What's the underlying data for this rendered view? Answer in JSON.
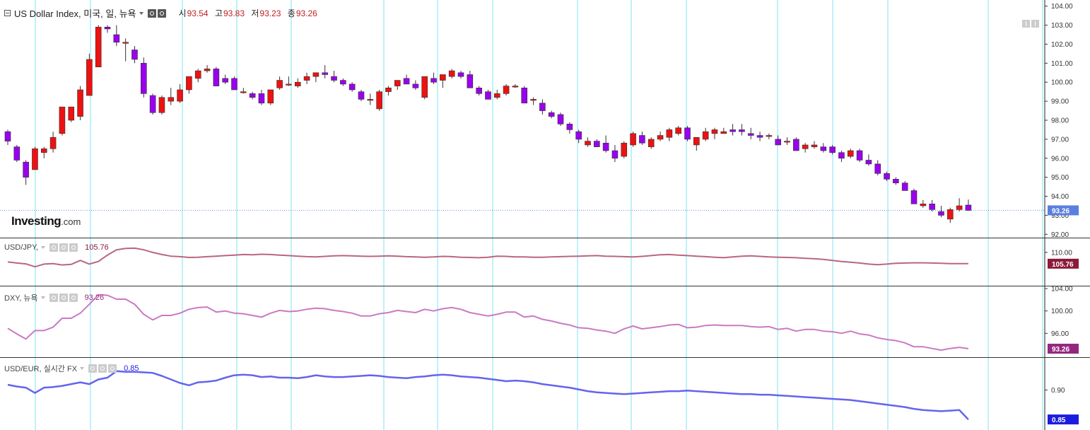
{
  "header": {
    "symbol_label": "US Dollar Index, 미국, 일, 뉴욕",
    "open_key": "시",
    "open_val": "93.54",
    "high_key": "고",
    "high_val": "93.83",
    "low_key": "저",
    "low_val": "93.23",
    "close_key": "종",
    "close_val": "93.26"
  },
  "logo": {
    "main": "Investing",
    "suffix": ".com"
  },
  "colors": {
    "bull": "#ee1111",
    "bear": "#9900ee",
    "wick": "#333333",
    "grid_cyan": "#7fe3f0",
    "price_line": "#6f8fe0",
    "usdjpy": "#b9677d",
    "dxy": "#c97ac3",
    "usdeur": "#6464ee",
    "badge_jpy": "#8b1a3a",
    "badge_dxy": "#94287f",
    "badge_eur": "#1c1ce0"
  },
  "chart_data": [
    {
      "type": "candlestick",
      "name": "US Dollar Index",
      "ylim": [
        91.9,
        104.1
      ],
      "y_ticks": [
        "104.00",
        "103.00",
        "102.00",
        "101.00",
        "100.00",
        "99.00",
        "98.00",
        "97.00",
        "96.00",
        "95.00",
        "94.00",
        "93.00",
        "92.00"
      ],
      "last_value_label": "93.26",
      "candles": [
        [
          97.4,
          97.5,
          96.7,
          96.9
        ],
        [
          96.6,
          96.7,
          95.8,
          95.9
        ],
        [
          95.8,
          95.9,
          94.6,
          95.0
        ],
        [
          95.4,
          96.6,
          95.4,
          96.5
        ],
        [
          96.3,
          96.6,
          96.0,
          96.5
        ],
        [
          96.5,
          97.4,
          96.3,
          97.1
        ],
        [
          97.3,
          98.7,
          97.2,
          98.7
        ],
        [
          98.0,
          98.7,
          97.9,
          98.7
        ],
        [
          98.2,
          99.8,
          98.0,
          99.6
        ],
        [
          99.3,
          101.5,
          99.3,
          101.2
        ],
        [
          100.8,
          103.0,
          100.8,
          102.9
        ],
        [
          102.9,
          103.0,
          102.6,
          102.8
        ],
        [
          102.5,
          103.0,
          101.9,
          102.1
        ],
        [
          102.1,
          102.3,
          101.1,
          102.1
        ],
        [
          101.7,
          101.9,
          101.0,
          101.2
        ],
        [
          101.0,
          101.3,
          99.2,
          99.4
        ],
        [
          99.3,
          99.4,
          98.3,
          98.4
        ],
        [
          98.4,
          99.3,
          98.3,
          99.2
        ],
        [
          99.0,
          99.7,
          98.8,
          99.2
        ],
        [
          99.0,
          99.9,
          98.9,
          99.6
        ],
        [
          99.6,
          100.3,
          99.4,
          100.3
        ],
        [
          100.2,
          100.7,
          100.0,
          100.6
        ],
        [
          100.6,
          100.9,
          100.5,
          100.7
        ],
        [
          100.7,
          100.8,
          99.8,
          99.8
        ],
        [
          100.2,
          100.4,
          99.9,
          100.0
        ],
        [
          100.2,
          100.3,
          99.6,
          99.6
        ],
        [
          99.5,
          99.7,
          99.4,
          99.5
        ],
        [
          99.4,
          99.5,
          99.1,
          99.2
        ],
        [
          99.4,
          99.6,
          98.8,
          98.9
        ],
        [
          98.9,
          99.6,
          98.8,
          99.6
        ],
        [
          99.7,
          100.3,
          99.6,
          100.1
        ],
        [
          99.9,
          100.3,
          99.8,
          99.9
        ],
        [
          99.8,
          100.2,
          99.7,
          100.0
        ],
        [
          100.1,
          100.5,
          99.9,
          100.3
        ],
        [
          100.3,
          100.5,
          100.0,
          100.5
        ],
        [
          100.5,
          100.9,
          100.2,
          100.4
        ],
        [
          100.3,
          100.6,
          100.0,
          100.1
        ],
        [
          100.1,
          100.2,
          99.8,
          99.9
        ],
        [
          99.9,
          100.0,
          99.5,
          99.6
        ],
        [
          99.5,
          99.6,
          99.0,
          99.1
        ],
        [
          99.1,
          99.4,
          98.8,
          99.1
        ],
        [
          98.6,
          99.6,
          98.5,
          99.5
        ],
        [
          99.5,
          99.8,
          99.3,
          99.7
        ],
        [
          99.8,
          100.1,
          99.6,
          100.1
        ],
        [
          100.2,
          100.4,
          99.9,
          99.9
        ],
        [
          99.9,
          100.1,
          99.6,
          99.7
        ],
        [
          99.2,
          100.3,
          99.1,
          100.3
        ],
        [
          100.2,
          100.5,
          99.9,
          100.0
        ],
        [
          100.1,
          100.4,
          99.7,
          100.4
        ],
        [
          100.3,
          100.7,
          100.2,
          100.6
        ],
        [
          100.5,
          100.6,
          100.2,
          100.3
        ],
        [
          100.4,
          100.6,
          99.7,
          99.7
        ],
        [
          99.7,
          99.8,
          99.3,
          99.4
        ],
        [
          99.5,
          99.6,
          99.1,
          99.1
        ],
        [
          99.2,
          99.6,
          99.1,
          99.4
        ],
        [
          99.4,
          99.9,
          99.3,
          99.8
        ],
        [
          99.8,
          99.9,
          99.7,
          99.8
        ],
        [
          99.7,
          99.8,
          98.9,
          98.9
        ],
        [
          99.1,
          99.2,
          98.8,
          99.1
        ],
        [
          98.9,
          99.1,
          98.3,
          98.5
        ],
        [
          98.4,
          98.5,
          98.1,
          98.2
        ],
        [
          98.3,
          98.4,
          97.7,
          97.8
        ],
        [
          97.8,
          97.9,
          97.3,
          97.5
        ],
        [
          97.4,
          97.5,
          96.8,
          97.0
        ],
        [
          96.7,
          97.1,
          96.6,
          96.9
        ],
        [
          96.9,
          97.0,
          96.6,
          96.6
        ],
        [
          96.8,
          97.2,
          96.3,
          96.4
        ],
        [
          96.4,
          96.7,
          95.8,
          96.0
        ],
        [
          96.1,
          96.9,
          96.0,
          96.8
        ],
        [
          96.7,
          97.4,
          96.6,
          97.3
        ],
        [
          97.2,
          97.4,
          96.7,
          96.8
        ],
        [
          96.6,
          97.1,
          96.5,
          97.0
        ],
        [
          97.0,
          97.4,
          96.9,
          97.2
        ],
        [
          97.1,
          97.6,
          96.9,
          97.5
        ],
        [
          97.3,
          97.7,
          97.2,
          97.6
        ],
        [
          97.6,
          97.7,
          96.9,
          97.0
        ],
        [
          96.7,
          97.1,
          96.4,
          97.1
        ],
        [
          97.0,
          97.6,
          96.9,
          97.4
        ],
        [
          97.3,
          97.6,
          97.0,
          97.5
        ],
        [
          97.3,
          97.6,
          97.3,
          97.4
        ],
        [
          97.5,
          97.8,
          97.2,
          97.4
        ],
        [
          97.5,
          97.8,
          97.2,
          97.4
        ],
        [
          97.3,
          97.6,
          97.0,
          97.2
        ],
        [
          97.2,
          97.4,
          96.9,
          97.1
        ],
        [
          97.2,
          97.3,
          97.0,
          97.2
        ],
        [
          97.0,
          97.2,
          96.7,
          96.7
        ],
        [
          96.9,
          97.1,
          96.7,
          96.9
        ],
        [
          97.0,
          97.1,
          96.4,
          96.4
        ],
        [
          96.5,
          96.8,
          96.3,
          96.7
        ],
        [
          96.6,
          96.9,
          96.5,
          96.7
        ],
        [
          96.6,
          96.8,
          96.3,
          96.4
        ],
        [
          96.6,
          96.7,
          96.2,
          96.3
        ],
        [
          96.3,
          96.4,
          95.8,
          96.0
        ],
        [
          96.1,
          96.5,
          96.0,
          96.4
        ],
        [
          96.4,
          96.5,
          95.8,
          95.9
        ],
        [
          95.9,
          96.2,
          95.6,
          95.7
        ],
        [
          95.7,
          95.9,
          95.1,
          95.2
        ],
        [
          95.2,
          95.3,
          94.8,
          94.9
        ],
        [
          94.9,
          95.0,
          94.6,
          94.7
        ],
        [
          94.7,
          94.8,
          94.3,
          94.3
        ],
        [
          94.3,
          94.4,
          93.6,
          93.6
        ],
        [
          93.5,
          93.8,
          93.4,
          93.6
        ],
        [
          93.6,
          93.8,
          93.2,
          93.3
        ],
        [
          93.2,
          93.5,
          92.9,
          93.0
        ],
        [
          92.8,
          93.4,
          92.6,
          93.3
        ],
        [
          93.3,
          93.9,
          93.2,
          93.5
        ],
        [
          93.54,
          93.83,
          93.23,
          93.26
        ]
      ]
    },
    {
      "type": "line",
      "name": "USD/JPY",
      "title": "USD/JPY,",
      "last_value_label": "105.76",
      "ylim": [
        98.0,
        114.5
      ],
      "y_ticks": [
        "110.00"
      ],
      "values": [
        106.4,
        106.0,
        105.7,
        104.6,
        105.6,
        105.8,
        105.3,
        105.5,
        107.0,
        105.6,
        106.6,
        109.0,
        111.0,
        111.5,
        111.6,
        111.0,
        110.0,
        109.2,
        108.6,
        108.4,
        108.1,
        108.2,
        108.4,
        108.6,
        108.8,
        109.0,
        109.2,
        109.1,
        109.3,
        109.2,
        109.0,
        108.8,
        108.6,
        108.4,
        108.3,
        108.5,
        108.7,
        108.8,
        108.7,
        108.6,
        108.5,
        108.6,
        108.7,
        108.6,
        108.4,
        108.3,
        108.2,
        108.3,
        108.5,
        108.4,
        108.2,
        108.1,
        108.0,
        108.2,
        108.6,
        108.5,
        108.3,
        108.3,
        108.2,
        108.2,
        108.3,
        108.4,
        108.5,
        108.6,
        108.7,
        108.8,
        108.6,
        108.5,
        108.4,
        108.3,
        108.5,
        108.8,
        109.1,
        109.2,
        109.0,
        108.8,
        108.6,
        108.4,
        108.2,
        108.0,
        108.3,
        108.6,
        108.7,
        108.5,
        108.3,
        108.2,
        108.1,
        108.0,
        107.8,
        107.6,
        107.4,
        107.0,
        106.6,
        106.3,
        106.0,
        105.6,
        105.4,
        105.6,
        105.9,
        106.0,
        106.1,
        106.1,
        106.0,
        105.9,
        105.8,
        105.8,
        105.76
      ]
    },
    {
      "type": "line",
      "name": "DXY",
      "title": "DXY, 뉴욕",
      "last_value_label": "93.26",
      "ylim": [
        92.0,
        104.0
      ],
      "y_ticks": [
        "104.00",
        "100.00",
        "96.00"
      ],
      "candle_close_ref": true
    },
    {
      "type": "line",
      "name": "USD/EUR",
      "title": "USD/EUR, 실시간 FX",
      "last_value_label": "0.85",
      "ylim": [
        0.8345,
        0.951
      ],
      "y_ticks": [
        "0.90"
      ],
      "values": [
        0.909,
        0.906,
        0.904,
        0.895,
        0.904,
        0.905,
        0.907,
        0.91,
        0.913,
        0.91,
        0.918,
        0.921,
        0.932,
        0.931,
        0.931,
        0.93,
        0.929,
        0.924,
        0.918,
        0.912,
        0.908,
        0.913,
        0.914,
        0.916,
        0.921,
        0.925,
        0.926,
        0.925,
        0.922,
        0.923,
        0.921,
        0.921,
        0.92,
        0.922,
        0.925,
        0.923,
        0.922,
        0.922,
        0.923,
        0.924,
        0.925,
        0.924,
        0.922,
        0.921,
        0.92,
        0.922,
        0.923,
        0.925,
        0.926,
        0.925,
        0.923,
        0.922,
        0.921,
        0.919,
        0.917,
        0.915,
        0.916,
        0.915,
        0.913,
        0.91,
        0.908,
        0.906,
        0.904,
        0.901,
        0.898,
        0.896,
        0.895,
        0.894,
        0.893,
        0.894,
        0.895,
        0.896,
        0.897,
        0.898,
        0.898,
        0.899,
        0.898,
        0.897,
        0.896,
        0.895,
        0.894,
        0.893,
        0.893,
        0.892,
        0.892,
        0.891,
        0.89,
        0.889,
        0.888,
        0.887,
        0.886,
        0.885,
        0.884,
        0.883,
        0.881,
        0.879,
        0.877,
        0.875,
        0.873,
        0.871,
        0.868,
        0.866,
        0.865,
        0.864,
        0.865,
        0.866,
        0.85
      ]
    }
  ]
}
